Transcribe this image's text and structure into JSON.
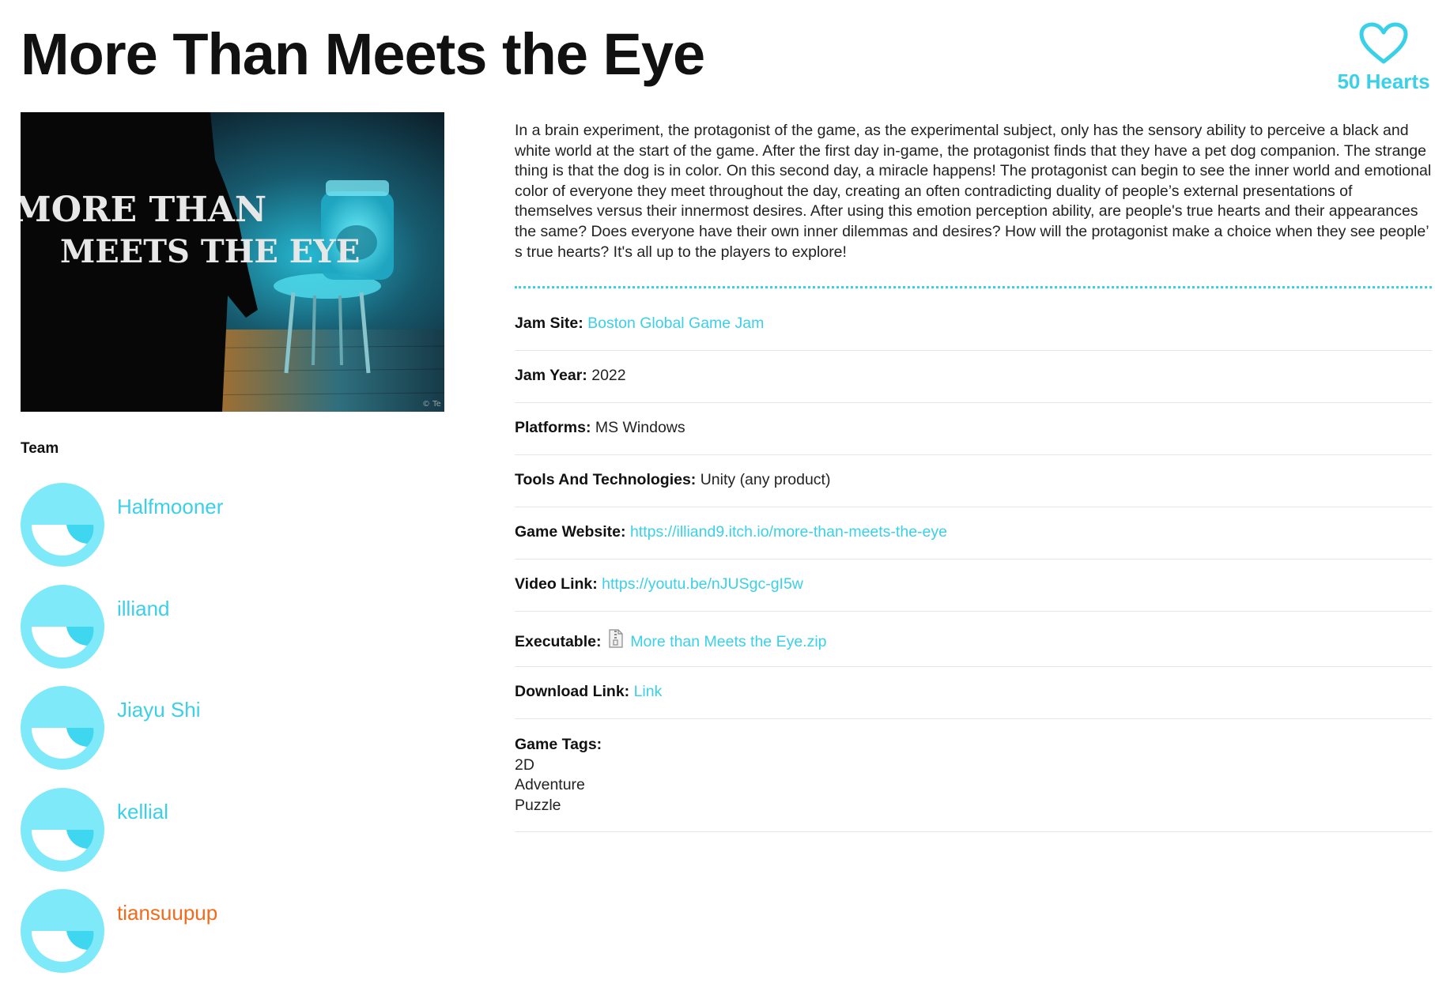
{
  "title": "More Than Meets the Eye",
  "hearts": {
    "count_label": "50 Hearts",
    "icon": "heart-outline-icon"
  },
  "cover_image": {
    "title_line1": "MORE THAN",
    "title_line2": "MEETS THE EYE",
    "credit": "© Te"
  },
  "team": {
    "heading": "Team",
    "members": [
      {
        "name": "Halfmooner",
        "avatar": "default-avatar-icon"
      },
      {
        "name": "illiand",
        "avatar": "default-avatar-icon"
      },
      {
        "name": "Jiayu Shi",
        "avatar": "default-avatar-icon"
      },
      {
        "name": "kellial",
        "avatar": "default-avatar-icon"
      },
      {
        "name": "tiansuupup",
        "avatar": "default-avatar-icon"
      }
    ]
  },
  "description": "In a brain experiment, the protagonist of the game, as the experimental subject, only has the sensory ability to perceive a black and white world at the start of the game. After the first day in-game, the protagonist finds that they have a pet dog companion. The strange thing is that the dog is in color. On this second day, a miracle happens! The protagonist can begin to see the inner world and emotional color of everyone they meet throughout the day, creating an often contradicting duality of people’s external presentations of themselves versus their innermost desires. After using this emotion perception ability, are people's true hearts and their appearances the same? Does everyone have their own inner dilemmas and desires? How will the protagonist make a choice when they see people’ s true hearts? It's all up to the players to explore!",
  "details": {
    "jam_site": {
      "label": "Jam Site:",
      "value": "Boston Global Game Jam"
    },
    "jam_year": {
      "label": "Jam Year:",
      "value": "2022"
    },
    "platforms": {
      "label": "Platforms:",
      "value": "MS Windows"
    },
    "tools": {
      "label": "Tools And Technologies:",
      "value": "Unity (any product)"
    },
    "website": {
      "label": "Game Website:",
      "value": "https://illiand9.itch.io/more-than-meets-the-eye"
    },
    "video": {
      "label": "Video Link:",
      "value": "https://youtu.be/nJUSgc-gI5w"
    },
    "executable": {
      "label": "Executable:",
      "value": "More than Meets the Eye.zip",
      "icon": "zip-file-icon"
    },
    "download": {
      "label": "Download Link:",
      "value": "Link"
    },
    "tags": {
      "label": "Game Tags:",
      "values": [
        "2D",
        "Adventure",
        "Puzzle"
      ]
    }
  },
  "colors": {
    "accent": "#3ad0e8",
    "avatar_light": "#7ee9f8",
    "avatar_dark": "#3fd7ef",
    "highlight": "#f26a1b",
    "text": "#111111"
  }
}
